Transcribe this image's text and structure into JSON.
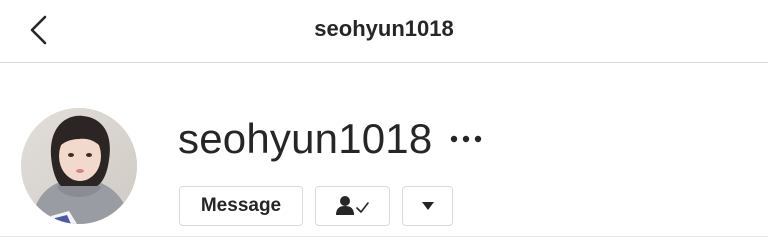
{
  "header": {
    "title": "seohyun1018",
    "back_icon": "chevron-left-icon"
  },
  "profile": {
    "username": "seohyun1018",
    "more_icon": "more-horizontal-icon",
    "avatar": "profile-photo"
  },
  "actions": {
    "message_label": "Message",
    "following_icon": "person-check-icon",
    "dropdown_icon": "triangle-down-icon"
  },
  "colors": {
    "text": "#262626",
    "border": "#dbdbdb"
  }
}
